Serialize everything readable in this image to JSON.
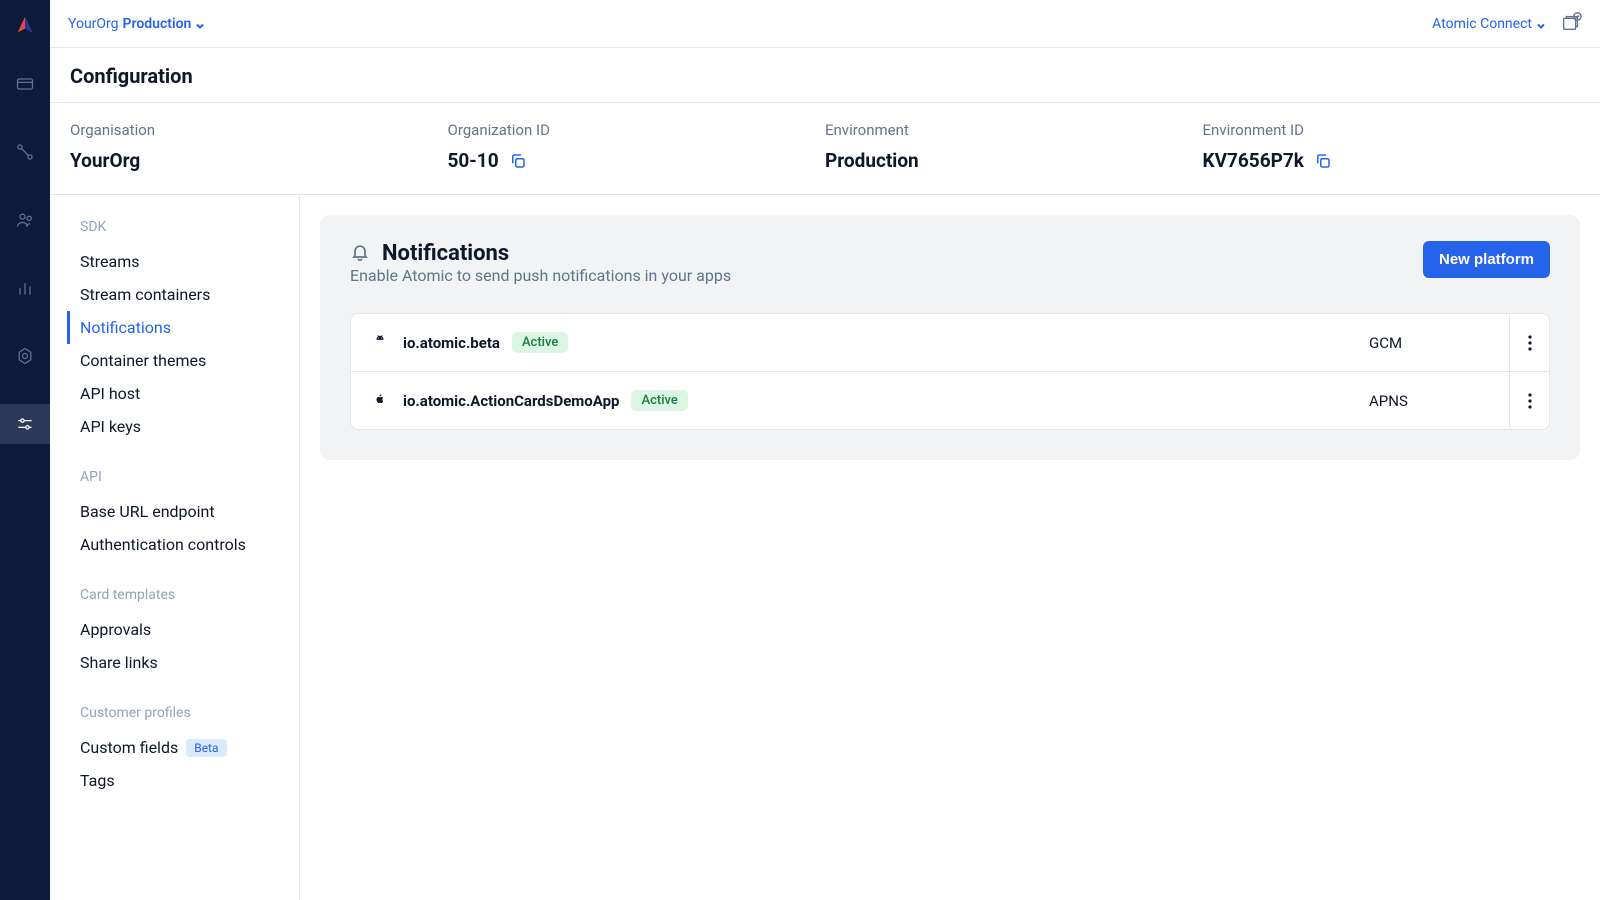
{
  "topbar": {
    "org": "YourOrg",
    "env": "Production",
    "connect": "Atomic Connect"
  },
  "page_title": "Configuration",
  "info": {
    "org_label": "Organisation",
    "org_value": "YourOrg",
    "orgid_label": "Organization ID",
    "orgid_value": "50-10",
    "env_label": "Environment",
    "env_value": "Production",
    "envid_label": "Environment ID",
    "envid_value": "KV7656P7k"
  },
  "subnav": {
    "sdk_heading": "SDK",
    "sdk_items": [
      "Streams",
      "Stream containers",
      "Notifications",
      "Container themes",
      "API host",
      "API keys"
    ],
    "api_heading": "API",
    "api_items": [
      "Base URL endpoint",
      "Authentication controls"
    ],
    "tpl_heading": "Card templates",
    "tpl_items": [
      "Approvals",
      "Share links"
    ],
    "cust_heading": "Customer profiles",
    "cust_items": [
      "Custom fields",
      "Tags"
    ],
    "beta_label": "Beta"
  },
  "panel": {
    "title": "Notifications",
    "subtitle": "Enable Atomic to send push notifications in your apps",
    "new_button": "New platform"
  },
  "platforms": [
    {
      "name": "io.atomic.beta",
      "status": "Active",
      "type": "GCM",
      "os": "android"
    },
    {
      "name": "io.atomic.ActionCardsDemoApp",
      "status": "Active",
      "type": "APNS",
      "os": "apple"
    }
  ]
}
